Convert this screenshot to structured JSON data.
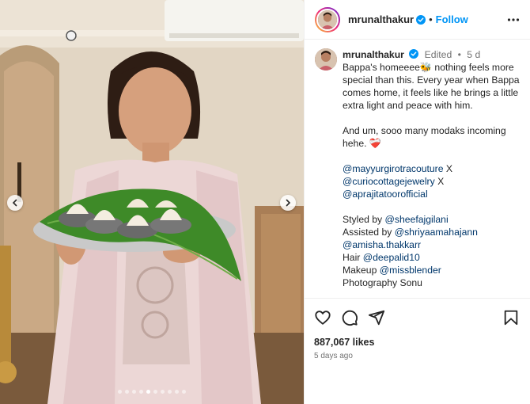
{
  "post": {
    "username": "mrunalthakur",
    "follow_label": "Follow",
    "separator": "•"
  },
  "caption": {
    "username": "mrunalthakur",
    "edited": "Edited",
    "age": "5 d",
    "lines": [
      "Bappa's homeeee🐝 nothing feels more special than this. Every year when Bappa comes home, it feels like he brings a little extra light and peace with him.",
      "And um, sooo many modaks incoming hehe. ❤️‍🩹"
    ],
    "credits": {
      "tag1": "@mayyurgirotracouture",
      "x1": " X",
      "tag2": "@curiocottagejewelry",
      "x2": " X",
      "tag3": "@aprajitatoorofficial",
      "styled_label": "Styled by ",
      "styled_tag": "@sheefajgilani",
      "assisted_label": "Assisted by ",
      "assisted_tag1": "@shriyaamahajann",
      "assisted_tag2": "@amisha.thakkarr",
      "hair_label": "Hair ",
      "hair_tag": "@deepalid10",
      "makeup_label": "Makeup ",
      "makeup_tag": "@missblender",
      "photography": "Photography Sonu"
    }
  },
  "stats": {
    "likes": "887,067 likes",
    "time": "5 days ago"
  },
  "carousel": {
    "total": 10,
    "active_index": 4
  },
  "colors": {
    "link": "#00376b",
    "follow": "#0095f6",
    "muted": "#737373",
    "text": "#262626"
  },
  "icons": [
    "verified-badge-icon",
    "more-options-icon",
    "heart-icon",
    "comment-icon",
    "share-icon",
    "bookmark-icon",
    "chevron-left-icon",
    "chevron-right-icon"
  ]
}
